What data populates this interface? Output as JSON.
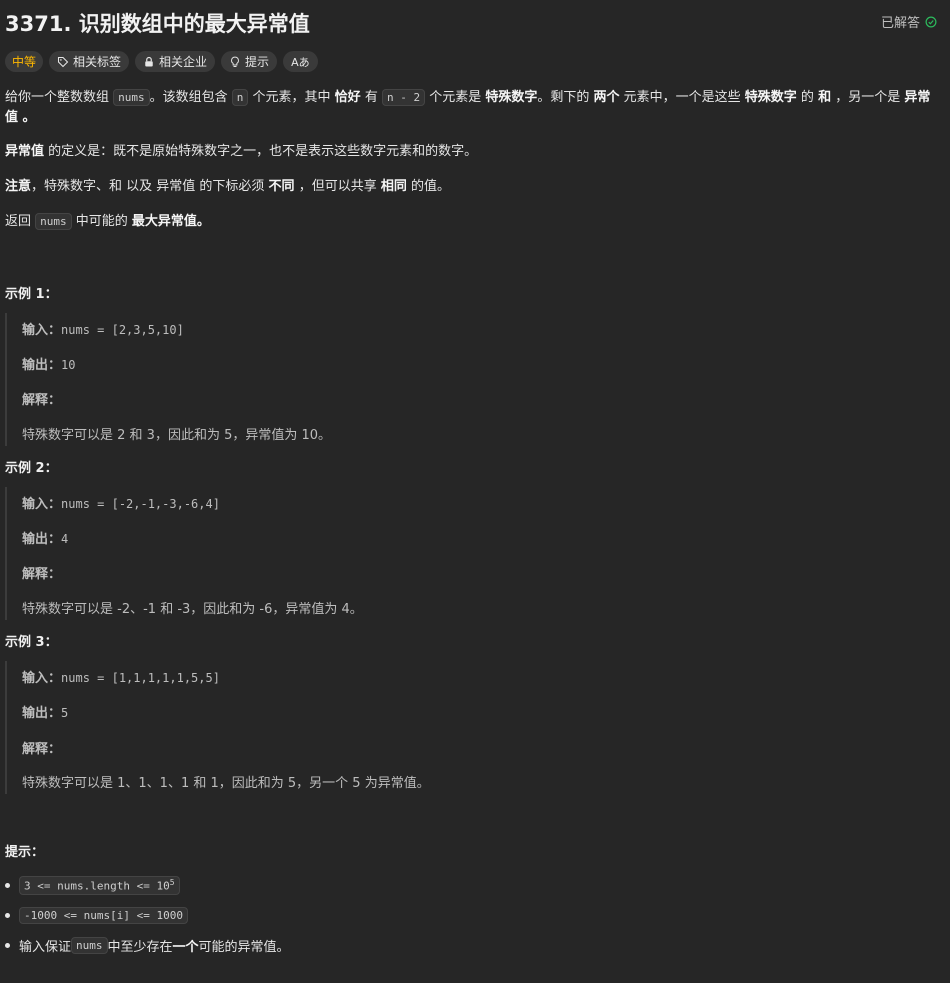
{
  "header": {
    "title": "3371. 识别数组中的最大异常值",
    "solved_label": "已解答"
  },
  "tags": {
    "difficulty": "中等",
    "related_tags": "相关标签",
    "related_companies": "相关企业",
    "hint": "提示",
    "translate": "Aあ"
  },
  "desc": {
    "p1a": "给你一个整数数组 ",
    "p1_code1": "nums",
    "p1b": "。该数组包含 ",
    "p1_code2": "n",
    "p1c": " 个元素，其中 ",
    "p1_b1": "恰好",
    "p1d": " 有 ",
    "p1_code3": "n - 2",
    "p1e": " 个元素是 ",
    "p1_b2": "特殊数字",
    "p1f": "。剩下的 ",
    "p1_b3": "两个",
    "p1g": " 元素中，一个是这些 ",
    "p1_b4": "特殊数字",
    "p1h": " 的 ",
    "p1_b5": "和",
    "p1i": " ，另一个是 ",
    "p1_b6": "异常值",
    "p1j": " 。",
    "p2_b": "异常值",
    "p2": " 的定义是：既不是原始特殊数字之一，也不是表示这些数字元素和的数字。",
    "p3_b1": "注意",
    "p3a": "，特殊数字、和 以及 异常值 的下标必须 ",
    "p3_b2": "不同",
    "p3b": " ，但可以共享 ",
    "p3_b3": "相同",
    "p3c": " 的值。",
    "p4a": "返回 ",
    "p4_code": "nums",
    "p4b": " 中可能的 ",
    "p4_b": "最大异常值。"
  },
  "examples": [
    {
      "title": "示例 1：",
      "input_label": "输入：",
      "input": "nums = [2,3,5,10]",
      "output_label": "输出：",
      "output": "10",
      "explain_label": "解释：",
      "explain": "特殊数字可以是 2 和 3，因此和为 5，异常值为 10。"
    },
    {
      "title": "示例 2：",
      "input_label": "输入：",
      "input": "nums = [-2,-1,-3,-6,4]",
      "output_label": "输出：",
      "output": "4",
      "explain_label": "解释：",
      "explain": "特殊数字可以是 -2、-1 和 -3，因此和为 -6，异常值为 4。"
    },
    {
      "title": "示例 3：",
      "input_label": "输入：",
      "input": "nums = [1,1,1,1,1,5,5]",
      "output_label": "输出：",
      "output": "5",
      "explain_label": "解释：",
      "explain": "特殊数字可以是 1、1、1、1 和 1，因此和为 5，另一个 5 为异常值。"
    }
  ],
  "constraints": {
    "title": "提示：",
    "c1": "3 <= nums.length <= 10",
    "c1_sup": "5",
    "c2": "-1000 <= nums[i] <= 1000",
    "c3a": "输入保证 ",
    "c3_code": "nums",
    "c3b": " 中至少存在 ",
    "c3_b": "一个",
    "c3c": " 可能的异常值。"
  },
  "colors": {
    "background": "#262626",
    "difficulty_medium": "#ffb800",
    "solved_icon": "#2cbb5d"
  }
}
